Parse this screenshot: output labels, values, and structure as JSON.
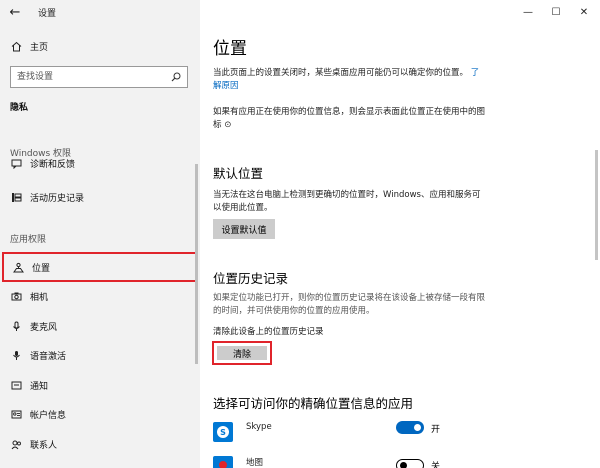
{
  "titlebar": {
    "title": "设置",
    "back_glyph": "←",
    "minimize_glyph": "—",
    "maximize_glyph": "☐",
    "close_glyph": "✕"
  },
  "sidebar": {
    "home": {
      "label": "主页",
      "icon": "home-icon"
    },
    "search": {
      "placeholder": "查找设置",
      "icon": "search-icon"
    },
    "privacy_heading": "隐私",
    "windows_permissions_label": "Windows 权限",
    "windows_items": [
      {
        "label": "诊断和反馈",
        "icon": "feedback-icon"
      },
      {
        "label": "活动历史记录",
        "icon": "activity-history-icon"
      }
    ],
    "app_permissions_label": "应用权限",
    "app_items": [
      {
        "label": "位置",
        "icon": "location-icon",
        "selected": true
      },
      {
        "label": "相机",
        "icon": "camera-icon"
      },
      {
        "label": "麦克风",
        "icon": "microphone-icon"
      },
      {
        "label": "语音激活",
        "icon": "voice-activation-icon"
      },
      {
        "label": "通知",
        "icon": "notification-icon"
      },
      {
        "label": "帐户信息",
        "icon": "account-info-icon"
      },
      {
        "label": "联系人",
        "icon": "contacts-icon"
      }
    ]
  },
  "main": {
    "title": "位置",
    "intro_line1": "当此页面上的设置关闭时，某些桌面应用可能仍可以确定你的位置。",
    "intro_link_a": "了",
    "intro_link_b": "解原因",
    "icon_note_line1": "如果有应用正在使用你的位置信息，则会显示表面此位置正在使用中的图",
    "icon_note_line2": "标",
    "icon_note_glyph": "⊙",
    "default_location": {
      "heading": "默认位置",
      "desc_line1": "当无法在这台电脑上检测到更确切的位置时，Windows、应用和服务可",
      "desc_line2": "以使用此位置。",
      "button": "设置默认值"
    },
    "location_history": {
      "heading": "位置历史记录",
      "desc_line1": "如果定位功能已打开，则你的位置历史记录将在该设备上被存储一段有限",
      "desc_line2": "的时间，并可供使用你的位置的应用使用。",
      "clear_label": "清除此设备上的位置历史记录",
      "clear_button": "清除"
    },
    "apps_section": {
      "heading": "选择可访问你的精确位置信息的应用",
      "apps": [
        {
          "name": "Skype",
          "state": "开",
          "on": true
        },
        {
          "name": "地图",
          "state": "关",
          "on": false
        }
      ]
    }
  },
  "colors": {
    "accent": "#0067c0",
    "highlight_border": "#e0242b",
    "sidebar_bg": "#f2f2f2"
  }
}
